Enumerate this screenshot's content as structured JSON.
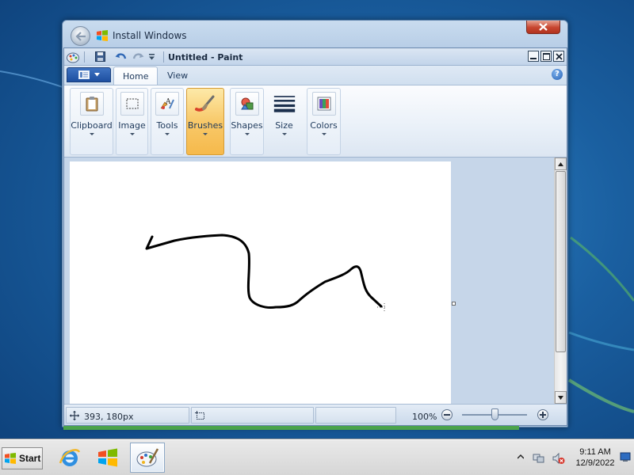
{
  "install_window": {
    "title": "Install Windows"
  },
  "paint": {
    "title": "Untitled - Paint",
    "tabs": [
      {
        "label": "Home",
        "active": true
      },
      {
        "label": "View",
        "active": false
      }
    ],
    "ribbon_groups": [
      {
        "label": "Clipboard",
        "icon": "clipboard-icon",
        "active": false
      },
      {
        "label": "Image",
        "icon": "select-icon",
        "active": false
      },
      {
        "label": "Tools",
        "icon": "tools-icon",
        "active": false
      },
      {
        "label": "Brushes",
        "icon": "brush-icon",
        "active": true
      },
      {
        "label": "Shapes",
        "icon": "shapes-icon",
        "active": false
      },
      {
        "label": "Size",
        "icon": "size-lines-icon",
        "active": false
      },
      {
        "label": "Colors",
        "icon": "colors-icon",
        "active": false
      }
    ],
    "status": {
      "cursor_position": "393, 180px",
      "zoom": "100%"
    }
  },
  "taskbar": {
    "start_label": "Start",
    "apps": [
      {
        "name": "internet-explorer",
        "active": false
      },
      {
        "name": "windows-media",
        "active": false
      },
      {
        "name": "paint",
        "active": true
      }
    ],
    "clock": {
      "time": "9:11 AM",
      "date": "12/9/2022"
    }
  },
  "colors": {
    "accent_brushes": "#f6b94b",
    "close_red": "#c7452f"
  }
}
